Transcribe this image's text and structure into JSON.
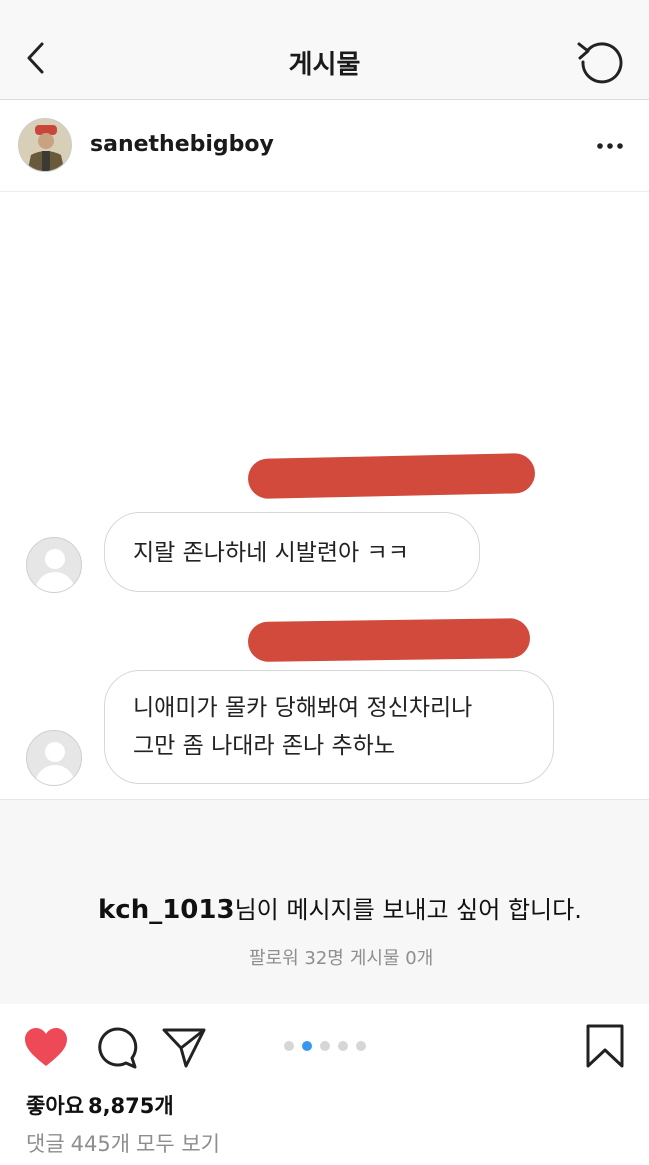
{
  "topbar": {
    "title": "게시물",
    "back_icon": "chevron-left-icon",
    "refresh_icon": "refresh-icon"
  },
  "post_header": {
    "username": "sanethebigboy",
    "more_icon": "more-horizontal-icon"
  },
  "chat": {
    "messages": [
      {
        "text": "지랄 존나하네 시발련아 ㅋㅋ"
      },
      {
        "line1": "니애미가 몰카 당해봐여 정신차리나",
        "line2": "그만 좀 나대라 존나 추하노"
      }
    ],
    "redaction_color": "#d24a3c"
  },
  "message_request": {
    "sender": "kch_1013",
    "text": "님이 메시지를 보내고 싶어 합니다.",
    "followers": "팔로워 32명",
    "posts": "게시물 0개"
  },
  "carousel": {
    "total": 5,
    "active_index": 1,
    "active_color": "#3897f0"
  },
  "actions": {
    "liked": true,
    "heart_color": "#ed4956"
  },
  "stats": {
    "likes_label": "좋아요",
    "likes_count": "8,875개",
    "comments_label": "댓글",
    "comments_count": "445개",
    "view_all": "모두 보기"
  }
}
